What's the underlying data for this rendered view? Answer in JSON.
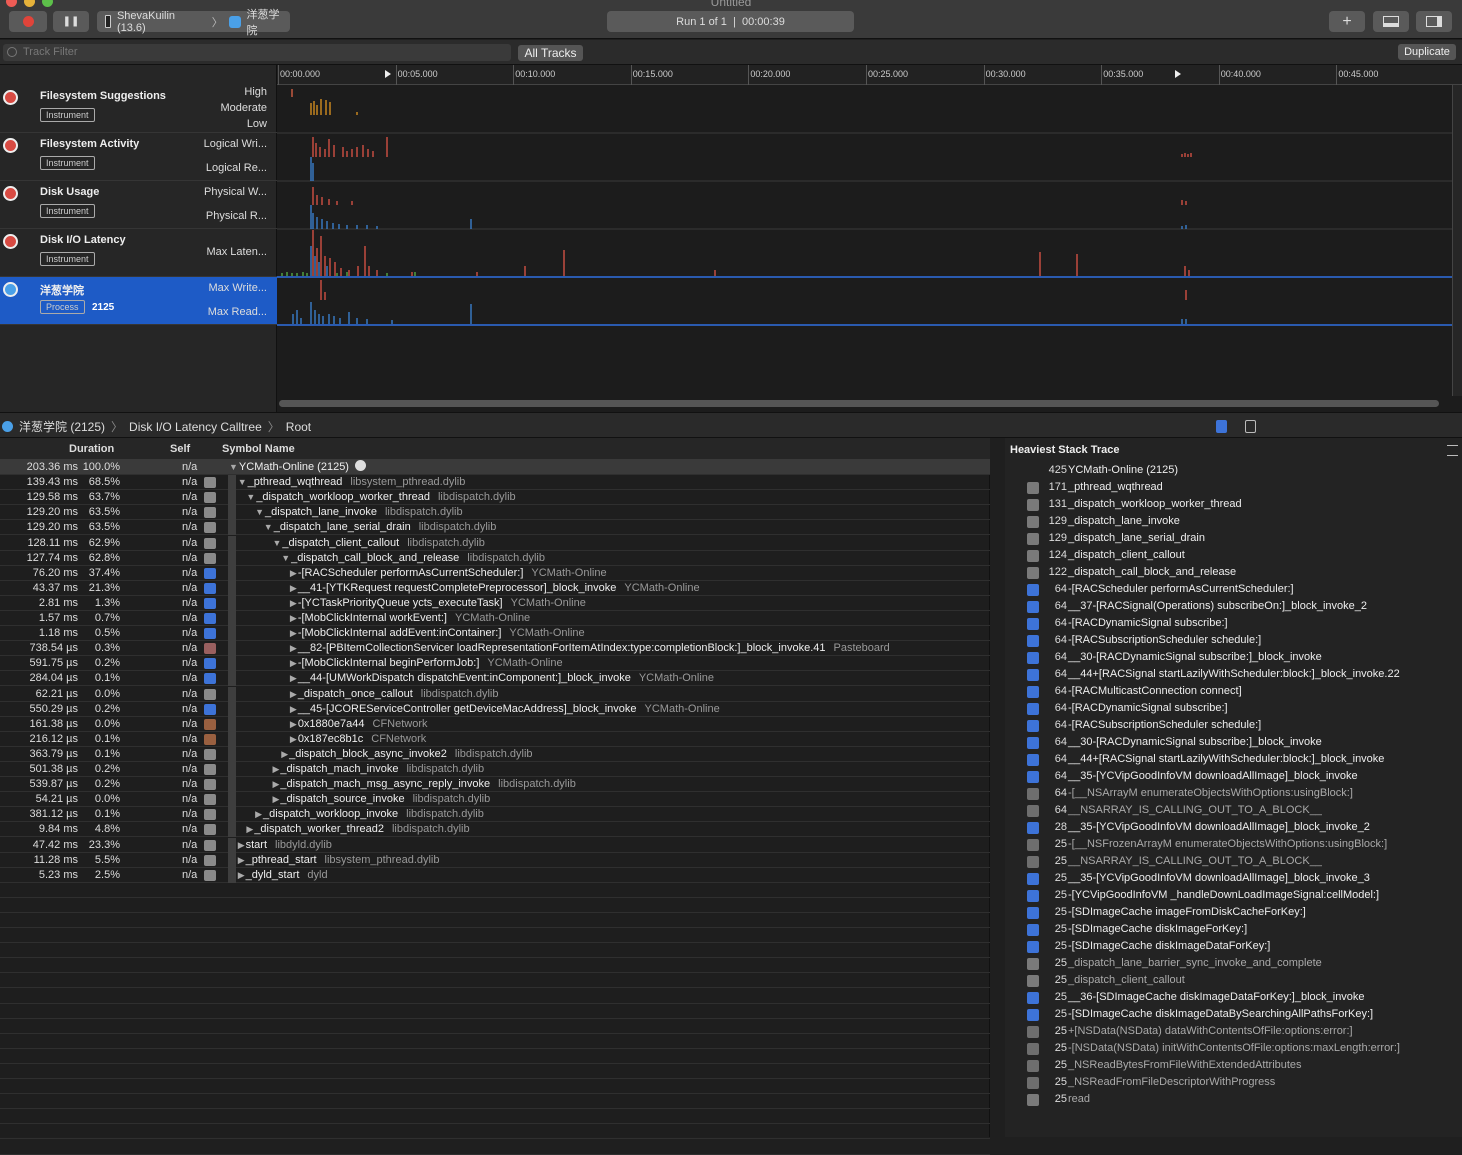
{
  "window": {
    "title": "Untitled"
  },
  "toolbar": {
    "target_device": "ShevaKuilin (13.6)",
    "target_app": "洋葱学院",
    "run_label": "Run 1 of 1  |  00:00:39",
    "add_label": "+"
  },
  "filterbar": {
    "placeholder": "Track Filter",
    "all_tracks": "All Tracks",
    "duplicate": "Duplicate"
  },
  "ruler": {
    "ticks": [
      "00:00.000",
      "00:05.000",
      "00:10.000",
      "00:15.000",
      "00:20.000",
      "00:25.000",
      "00:30.000",
      "00:35.000",
      "00:40.000",
      "00:45.000"
    ]
  },
  "tracks": [
    {
      "name": "Filesystem Suggestions",
      "badge": "Instrument",
      "labels": [
        "High",
        "Moderate",
        "Low"
      ]
    },
    {
      "name": "Filesystem Activity",
      "badge": "Instrument",
      "labels": [
        "Logical Wri...",
        "Logical Re..."
      ]
    },
    {
      "name": "Disk Usage",
      "badge": "Instrument",
      "labels": [
        "Physical W...",
        "Physical R..."
      ]
    },
    {
      "name": "Disk I/O Latency",
      "badge": "Instrument",
      "labels": [
        "Max Laten..."
      ]
    },
    {
      "name": "洋葱学院",
      "badge": "Process",
      "pid": "2125",
      "labels": [
        "Max Write...",
        "Max Read..."
      ]
    }
  ],
  "breadcrumb": [
    "洋葱学院 (2125)",
    "Disk I/O Latency Calltree",
    "Root"
  ],
  "calltree": {
    "headers": {
      "duration": "Duration",
      "self": "Self",
      "symbol": "Symbol Name"
    },
    "rows": [
      {
        "dur": "203.36 ms",
        "pct": "100.0%",
        "self": "n/a",
        "cat": "none",
        "indent": 0,
        "open": "▼",
        "sym": "YCMath-Online (2125)",
        "lib": ""
      },
      {
        "dur": "139.43 ms",
        "pct": "68.5%",
        "self": "n/a",
        "cat": "sys",
        "indent": 1,
        "open": "▼",
        "sym": "_pthread_wqthread",
        "lib": "libsystem_pthread.dylib"
      },
      {
        "dur": "129.58 ms",
        "pct": "63.7%",
        "self": "n/a",
        "cat": "sys",
        "indent": 2,
        "open": "▼",
        "sym": "_dispatch_workloop_worker_thread",
        "lib": "libdispatch.dylib"
      },
      {
        "dur": "129.20 ms",
        "pct": "63.5%",
        "self": "n/a",
        "cat": "sys",
        "indent": 3,
        "open": "▼",
        "sym": "_dispatch_lane_invoke",
        "lib": "libdispatch.dylib"
      },
      {
        "dur": "129.20 ms",
        "pct": "63.5%",
        "self": "n/a",
        "cat": "sys",
        "indent": 4,
        "open": "▼",
        "sym": "_dispatch_lane_serial_drain",
        "lib": "libdispatch.dylib"
      },
      {
        "dur": "128.11 ms",
        "pct": "62.9%",
        "self": "n/a",
        "cat": "sys",
        "indent": 5,
        "open": "▼",
        "sym": "_dispatch_client_callout",
        "lib": "libdispatch.dylib"
      },
      {
        "dur": "127.74 ms",
        "pct": "62.8%",
        "self": "n/a",
        "cat": "sys",
        "indent": 6,
        "open": "▼",
        "sym": "_dispatch_call_block_and_release",
        "lib": "libdispatch.dylib"
      },
      {
        "dur": "76.20 ms",
        "pct": "37.4%",
        "self": "n/a",
        "cat": "user",
        "indent": 7,
        "open": "▶",
        "sym": "-[RACScheduler performAsCurrentScheduler:]",
        "lib": "YCMath-Online"
      },
      {
        "dur": "43.37 ms",
        "pct": "21.3%",
        "self": "n/a",
        "cat": "user",
        "indent": 7,
        "open": "▶",
        "sym": "__41-[YTKRequest requestCompletePreprocessor]_block_invoke",
        "lib": "YCMath-Online"
      },
      {
        "dur": "2.81 ms",
        "pct": "1.3%",
        "self": "n/a",
        "cat": "user",
        "indent": 7,
        "open": "▶",
        "sym": "-[YCTaskPriorityQueue ycts_executeTask]",
        "lib": "YCMath-Online"
      },
      {
        "dur": "1.57 ms",
        "pct": "0.7%",
        "self": "n/a",
        "cat": "user",
        "indent": 7,
        "open": "▶",
        "sym": "-[MobClickInternal workEvent:]",
        "lib": "YCMath-Online"
      },
      {
        "dur": "1.18 ms",
        "pct": "0.5%",
        "self": "n/a",
        "cat": "user",
        "indent": 7,
        "open": "▶",
        "sym": "-[MobClickInternal addEvent:inContainer:]",
        "lib": "YCMath-Online"
      },
      {
        "dur": "738.54 µs",
        "pct": "0.3%",
        "self": "n/a",
        "cat": "pb",
        "indent": 7,
        "open": "▶",
        "sym": "__82-[PBItemCollectionServicer loadRepresentationForItemAtIndex:type:completionBlock:]_block_invoke.41",
        "lib": "Pasteboard"
      },
      {
        "dur": "591.75 µs",
        "pct": "0.2%",
        "self": "n/a",
        "cat": "user",
        "indent": 7,
        "open": "▶",
        "sym": "-[MobClickInternal beginPerformJob:]",
        "lib": "YCMath-Online"
      },
      {
        "dur": "284.04 µs",
        "pct": "0.1%",
        "self": "n/a",
        "cat": "user",
        "indent": 7,
        "open": "▶",
        "sym": "__44-[UMWorkDispatch dispatchEvent:inComponent:]_block_invoke",
        "lib": "YCMath-Online"
      },
      {
        "dur": "62.21 µs",
        "pct": "0.0%",
        "self": "n/a",
        "cat": "sys",
        "indent": 7,
        "open": "▶",
        "sym": "_dispatch_once_callout",
        "lib": "libdispatch.dylib"
      },
      {
        "dur": "550.29 µs",
        "pct": "0.2%",
        "self": "n/a",
        "cat": "user",
        "indent": 7,
        "open": "▶",
        "sym": "__45-[JCOREServiceController getDeviceMacAddress]_block_invoke",
        "lib": "YCMath-Online"
      },
      {
        "dur": "161.38 µs",
        "pct": "0.0%",
        "self": "n/a",
        "cat": "net",
        "indent": 7,
        "open": "▶",
        "sym": "0x1880e7a44",
        "lib": "CFNetwork"
      },
      {
        "dur": "216.12 µs",
        "pct": "0.1%",
        "self": "n/a",
        "cat": "net",
        "indent": 7,
        "open": "▶",
        "sym": "0x187ec8b1c",
        "lib": "CFNetwork"
      },
      {
        "dur": "363.79 µs",
        "pct": "0.1%",
        "self": "n/a",
        "cat": "sys",
        "indent": 6,
        "open": "▶",
        "sym": "_dispatch_block_async_invoke2",
        "lib": "libdispatch.dylib"
      },
      {
        "dur": "501.38 µs",
        "pct": "0.2%",
        "self": "n/a",
        "cat": "sys",
        "indent": 5,
        "open": "▶",
        "sym": "_dispatch_mach_invoke",
        "lib": "libdispatch.dylib"
      },
      {
        "dur": "539.87 µs",
        "pct": "0.2%",
        "self": "n/a",
        "cat": "sys",
        "indent": 5,
        "open": "▶",
        "sym": "_dispatch_mach_msg_async_reply_invoke",
        "lib": "libdispatch.dylib"
      },
      {
        "dur": "54.21 µs",
        "pct": "0.0%",
        "self": "n/a",
        "cat": "sys",
        "indent": 5,
        "open": "▶",
        "sym": "_dispatch_source_invoke",
        "lib": "libdispatch.dylib"
      },
      {
        "dur": "381.12 µs",
        "pct": "0.1%",
        "self": "n/a",
        "cat": "sys",
        "indent": 3,
        "open": "▶",
        "sym": "_dispatch_workloop_invoke",
        "lib": "libdispatch.dylib"
      },
      {
        "dur": "9.84 ms",
        "pct": "4.8%",
        "self": "n/a",
        "cat": "sys",
        "indent": 2,
        "open": "▶",
        "sym": "_dispatch_worker_thread2",
        "lib": "libdispatch.dylib"
      },
      {
        "dur": "47.42 ms",
        "pct": "23.3%",
        "self": "n/a",
        "cat": "sys",
        "indent": 1,
        "open": "▶",
        "sym": "start",
        "lib": "libdyld.dylib"
      },
      {
        "dur": "11.28 ms",
        "pct": "5.5%",
        "self": "n/a",
        "cat": "sys",
        "indent": 1,
        "open": "▶",
        "sym": "_pthread_start",
        "lib": "libsystem_pthread.dylib"
      },
      {
        "dur": "5.23 ms",
        "pct": "2.5%",
        "self": "n/a",
        "cat": "sys",
        "indent": 1,
        "open": "▶",
        "sym": "_dyld_start",
        "lib": "dyld"
      }
    ]
  },
  "heaviest": {
    "title": "Heaviest Stack Trace",
    "rows": [
      {
        "cnt": "425",
        "sym": "YCMath-Online (2125)",
        "cat": "none"
      },
      {
        "cnt": "171",
        "sym": "_pthread_wqthread",
        "cat": "sys"
      },
      {
        "cnt": "131",
        "sym": "_dispatch_workloop_worker_thread",
        "cat": "sys"
      },
      {
        "cnt": "129",
        "sym": "_dispatch_lane_invoke",
        "cat": "sys"
      },
      {
        "cnt": "129",
        "sym": "_dispatch_lane_serial_drain",
        "cat": "sys"
      },
      {
        "cnt": "124",
        "sym": "_dispatch_client_callout",
        "cat": "sys"
      },
      {
        "cnt": "122",
        "sym": "_dispatch_call_block_and_release",
        "cat": "sys"
      },
      {
        "cnt": "64",
        "sym": "-[RACScheduler performAsCurrentScheduler:]",
        "cat": "user"
      },
      {
        "cnt": "64",
        "sym": "__37-[RACSignal(Operations) subscribeOn:]_block_invoke_2",
        "cat": "user"
      },
      {
        "cnt": "64",
        "sym": "-[RACDynamicSignal subscribe:]",
        "cat": "user"
      },
      {
        "cnt": "64",
        "sym": "-[RACSubscriptionScheduler schedule:]",
        "cat": "user"
      },
      {
        "cnt": "64",
        "sym": "__30-[RACDynamicSignal subscribe:]_block_invoke",
        "cat": "user"
      },
      {
        "cnt": "64",
        "sym": "__44+[RACSignal startLazilyWithScheduler:block:]_block_invoke.22",
        "cat": "user"
      },
      {
        "cnt": "64",
        "sym": "-[RACMulticastConnection connect]",
        "cat": "user"
      },
      {
        "cnt": "64",
        "sym": "-[RACDynamicSignal subscribe:]",
        "cat": "user"
      },
      {
        "cnt": "64",
        "sym": "-[RACSubscriptionScheduler schedule:]",
        "cat": "user"
      },
      {
        "cnt": "64",
        "sym": "__30-[RACDynamicSignal subscribe:]_block_invoke",
        "cat": "user"
      },
      {
        "cnt": "64",
        "sym": "__44+[RACSignal startLazilyWithScheduler:block:]_block_invoke",
        "cat": "user"
      },
      {
        "cnt": "64",
        "sym": "__35-[YCVipGoodInfoVM downloadAllImage]_block_invoke",
        "cat": "user"
      },
      {
        "cnt": "64",
        "sym": "-[__NSArrayM enumerateObjectsWithOptions:usingBlock:]",
        "cat": "grid"
      },
      {
        "cnt": "64",
        "sym": "__NSARRAY_IS_CALLING_OUT_TO_A_BLOCK__",
        "cat": "grid"
      },
      {
        "cnt": "28",
        "sym": "__35-[YCVipGoodInfoVM downloadAllImage]_block_invoke_2",
        "cat": "user"
      },
      {
        "cnt": "25",
        "sym": "-[__NSFrozenArrayM enumerateObjectsWithOptions:usingBlock:]",
        "cat": "grid"
      },
      {
        "cnt": "25",
        "sym": "__NSARRAY_IS_CALLING_OUT_TO_A_BLOCK__",
        "cat": "grid"
      },
      {
        "cnt": "25",
        "sym": "__35-[YCVipGoodInfoVM downloadAllImage]_block_invoke_3",
        "cat": "user"
      },
      {
        "cnt": "25",
        "sym": "-[YCVipGoodInfoVM _handleDownLoadImageSignal:cellModel:]",
        "cat": "user"
      },
      {
        "cnt": "25",
        "sym": "-[SDImageCache imageFromDiskCacheForKey:]",
        "cat": "user"
      },
      {
        "cnt": "25",
        "sym": "-[SDImageCache diskImageForKey:]",
        "cat": "user"
      },
      {
        "cnt": "25",
        "sym": "-[SDImageCache diskImageDataForKey:]",
        "cat": "user"
      },
      {
        "cnt": "25",
        "sym": "_dispatch_lane_barrier_sync_invoke_and_complete",
        "cat": "sys"
      },
      {
        "cnt": "25",
        "sym": "_dispatch_client_callout",
        "cat": "sys"
      },
      {
        "cnt": "25",
        "sym": "__36-[SDImageCache diskImageDataForKey:]_block_invoke",
        "cat": "user"
      },
      {
        "cnt": "25",
        "sym": "-[SDImageCache diskImageDataBySearchingAllPathsForKey:]",
        "cat": "user"
      },
      {
        "cnt": "25",
        "sym": "+[NSData(NSData) dataWithContentsOfFile:options:error:]",
        "cat": "grid"
      },
      {
        "cnt": "25",
        "sym": "-[NSData(NSData) initWithContentsOfFile:options:maxLength:error:]",
        "cat": "grid"
      },
      {
        "cnt": "25",
        "sym": "_NSReadBytesFromFileWithExtendedAttributes",
        "cat": "grid"
      },
      {
        "cnt": "25",
        "sym": "_NSReadFromFileDescriptorWithProgress",
        "cat": "grid"
      },
      {
        "cnt": "25",
        "sym": "read",
        "cat": "sys"
      }
    ]
  }
}
